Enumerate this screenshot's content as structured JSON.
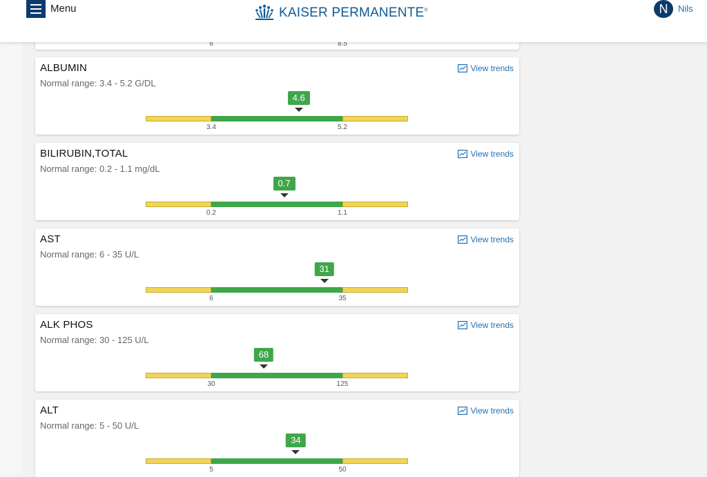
{
  "header": {
    "menu_label": "Menu",
    "logo_text": "KAISER PERMANENTE",
    "logo_mark": "®",
    "avatar_initial": "N",
    "user_name": "Nils",
    "brand_color": "#0d3b6e"
  },
  "colors": {
    "normal": "#3fa64a",
    "out_of_range": "#f0d559",
    "link": "#1f6fb2"
  },
  "partial_card": {
    "ticks": [
      "6",
      "8.5"
    ]
  },
  "tests": [
    {
      "name": "ALBUMIN",
      "range_text": "Normal range: 3.4 - 5.2 G/DL",
      "trends_label": "View trends",
      "low": 3.4,
      "high": 5.2,
      "value": 4.6,
      "low_label": "3.4",
      "high_label": "5.2",
      "value_label": "4.6"
    },
    {
      "name": "BILIRUBIN,TOTAL",
      "range_text": "Normal range: 0.2 - 1.1 mg/dL",
      "trends_label": "View trends",
      "low": 0.2,
      "high": 1.1,
      "value": 0.7,
      "low_label": "0.2",
      "high_label": "1.1",
      "value_label": "0.7"
    },
    {
      "name": "AST",
      "range_text": "Normal range: 6 - 35 U/L",
      "trends_label": "View trends",
      "low": 6,
      "high": 35,
      "value": 31,
      "low_label": "6",
      "high_label": "35",
      "value_label": "31"
    },
    {
      "name": "ALK PHOS",
      "range_text": "Normal range: 30 - 125 U/L",
      "trends_label": "View trends",
      "low": 30,
      "high": 125,
      "value": 68,
      "low_label": "30",
      "high_label": "125",
      "value_label": "68"
    },
    {
      "name": "ALT",
      "range_text": "Normal range: 5 - 50 U/L",
      "trends_label": "View trends",
      "low": 5,
      "high": 50,
      "value": 34,
      "low_label": "5",
      "high_label": "50",
      "value_label": "34"
    }
  ]
}
